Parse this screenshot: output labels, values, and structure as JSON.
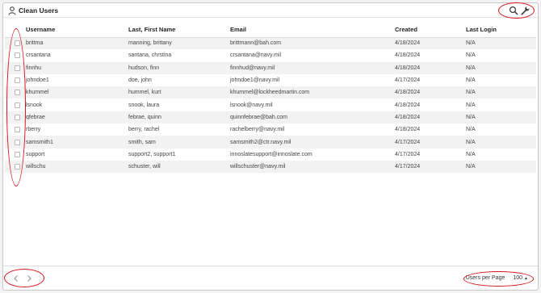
{
  "header": {
    "title": "Clean Users",
    "user_icon": "user-icon",
    "search_icon": "search-icon",
    "wrench_icon": "wrench-icon"
  },
  "table": {
    "columns": [
      "Username",
      "Last, First Name",
      "Email",
      "Created",
      "Last Login"
    ],
    "rows": [
      {
        "username": "brittma",
        "name": "manning, brittany",
        "email": "brittmann@bah.com",
        "created": "4/18/2024",
        "last_login": "N/A"
      },
      {
        "username": "crsantana",
        "name": "santana, chrstina",
        "email": "crsantana@navy.mil",
        "created": "4/18/2024",
        "last_login": "N/A"
      },
      {
        "username": "finnhu",
        "name": "hudson, finn",
        "email": "finnhud@navy.mil",
        "created": "4/18/2024",
        "last_login": "N/A"
      },
      {
        "username": "johndoe1",
        "name": "doe, john",
        "email": "johndoe1@navy.mil",
        "created": "4/17/2024",
        "last_login": "N/A"
      },
      {
        "username": "khummel",
        "name": "hummel, kurt",
        "email": "khummel@lockheedmartin.com",
        "created": "4/18/2024",
        "last_login": "N/A"
      },
      {
        "username": "lsnook",
        "name": "snook, laura",
        "email": "lsnook@navy.mil",
        "created": "4/18/2024",
        "last_login": "N/A"
      },
      {
        "username": "qfebrae",
        "name": "febrae, quinn",
        "email": "quinnfebrae@bah.com",
        "created": "4/18/2024",
        "last_login": "N/A"
      },
      {
        "username": "rberry",
        "name": "berry, rachel",
        "email": "rachelberry@navy.mil",
        "created": "4/18/2024",
        "last_login": "N/A"
      },
      {
        "username": "samsmith1",
        "name": "smith, sam",
        "email": "samsmith2@ctr.navy.mil",
        "created": "4/17/2024",
        "last_login": "N/A"
      },
      {
        "username": "support",
        "name": "support2, support1",
        "email": "innoslatesupport@innoslate.com",
        "created": "4/17/2024",
        "last_login": "N/A"
      },
      {
        "username": "willschu",
        "name": "schuster, will",
        "email": "willschuster@navy.mil",
        "created": "4/17/2024",
        "last_login": "N/A"
      }
    ]
  },
  "footer": {
    "prev_icon": "chevron-left-icon",
    "next_icon": "chevron-right-icon",
    "per_page_label": "Users per Page",
    "per_page_value": "100"
  },
  "colors": {
    "annotation": "#d8151b",
    "row_stripe": "#f2f2f2"
  }
}
